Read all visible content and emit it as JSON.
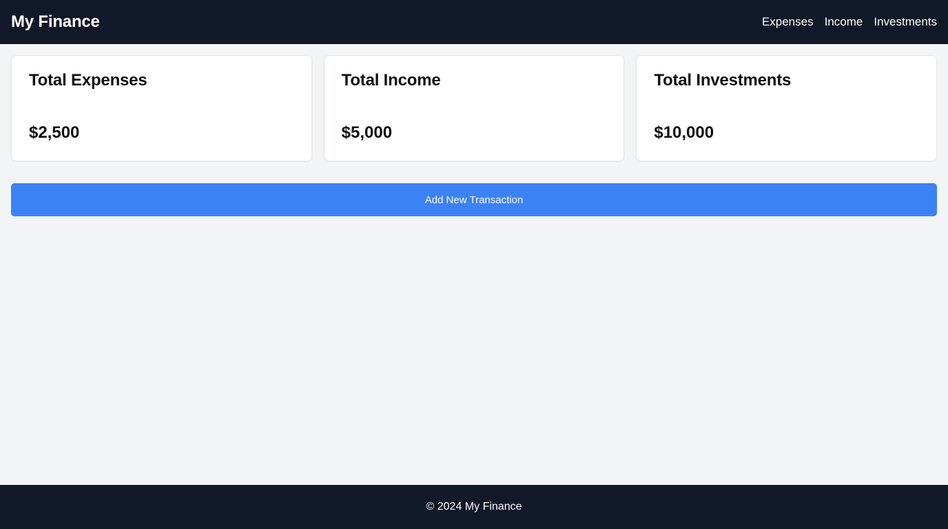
{
  "header": {
    "brand": "My Finance",
    "nav": [
      "Expenses",
      "Income",
      "Investments"
    ]
  },
  "cards": [
    {
      "title": "Total Expenses",
      "value": "$2,500"
    },
    {
      "title": "Total Income",
      "value": "$5,000"
    },
    {
      "title": "Total Investments",
      "value": "$10,000"
    }
  ],
  "actions": {
    "add_label": "Add New Transaction"
  },
  "footer": {
    "text": "© 2024 My Finance"
  },
  "colors": {
    "header_bg": "#111827",
    "accent": "#3b82f6",
    "page_bg": "#f3f4f6"
  }
}
